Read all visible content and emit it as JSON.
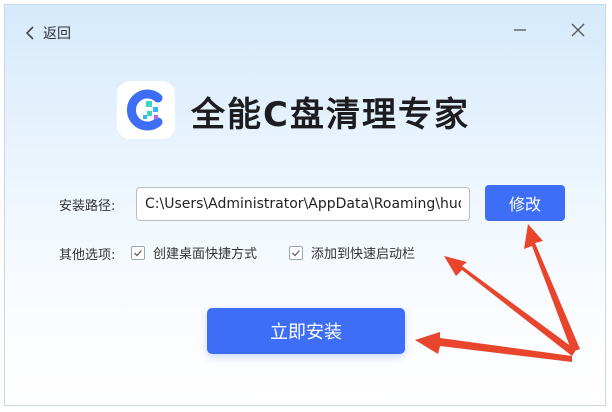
{
  "header": {
    "back_label": "返回"
  },
  "app": {
    "title": "全能C盘清理专家"
  },
  "install_path": {
    "label": "安装路径:",
    "value": "C:\\Users\\Administrator\\AppData\\Roaming\\hudu",
    "modify_label": "修改"
  },
  "options": {
    "label": "其他选项:",
    "items": [
      {
        "label": "创建桌面快捷方式",
        "checked": true
      },
      {
        "label": "添加到快速启动栏",
        "checked": true
      }
    ]
  },
  "install_button": {
    "label": "立即安装"
  },
  "colors": {
    "accent": "#3d6ef5",
    "arrow": "#e8452c"
  }
}
